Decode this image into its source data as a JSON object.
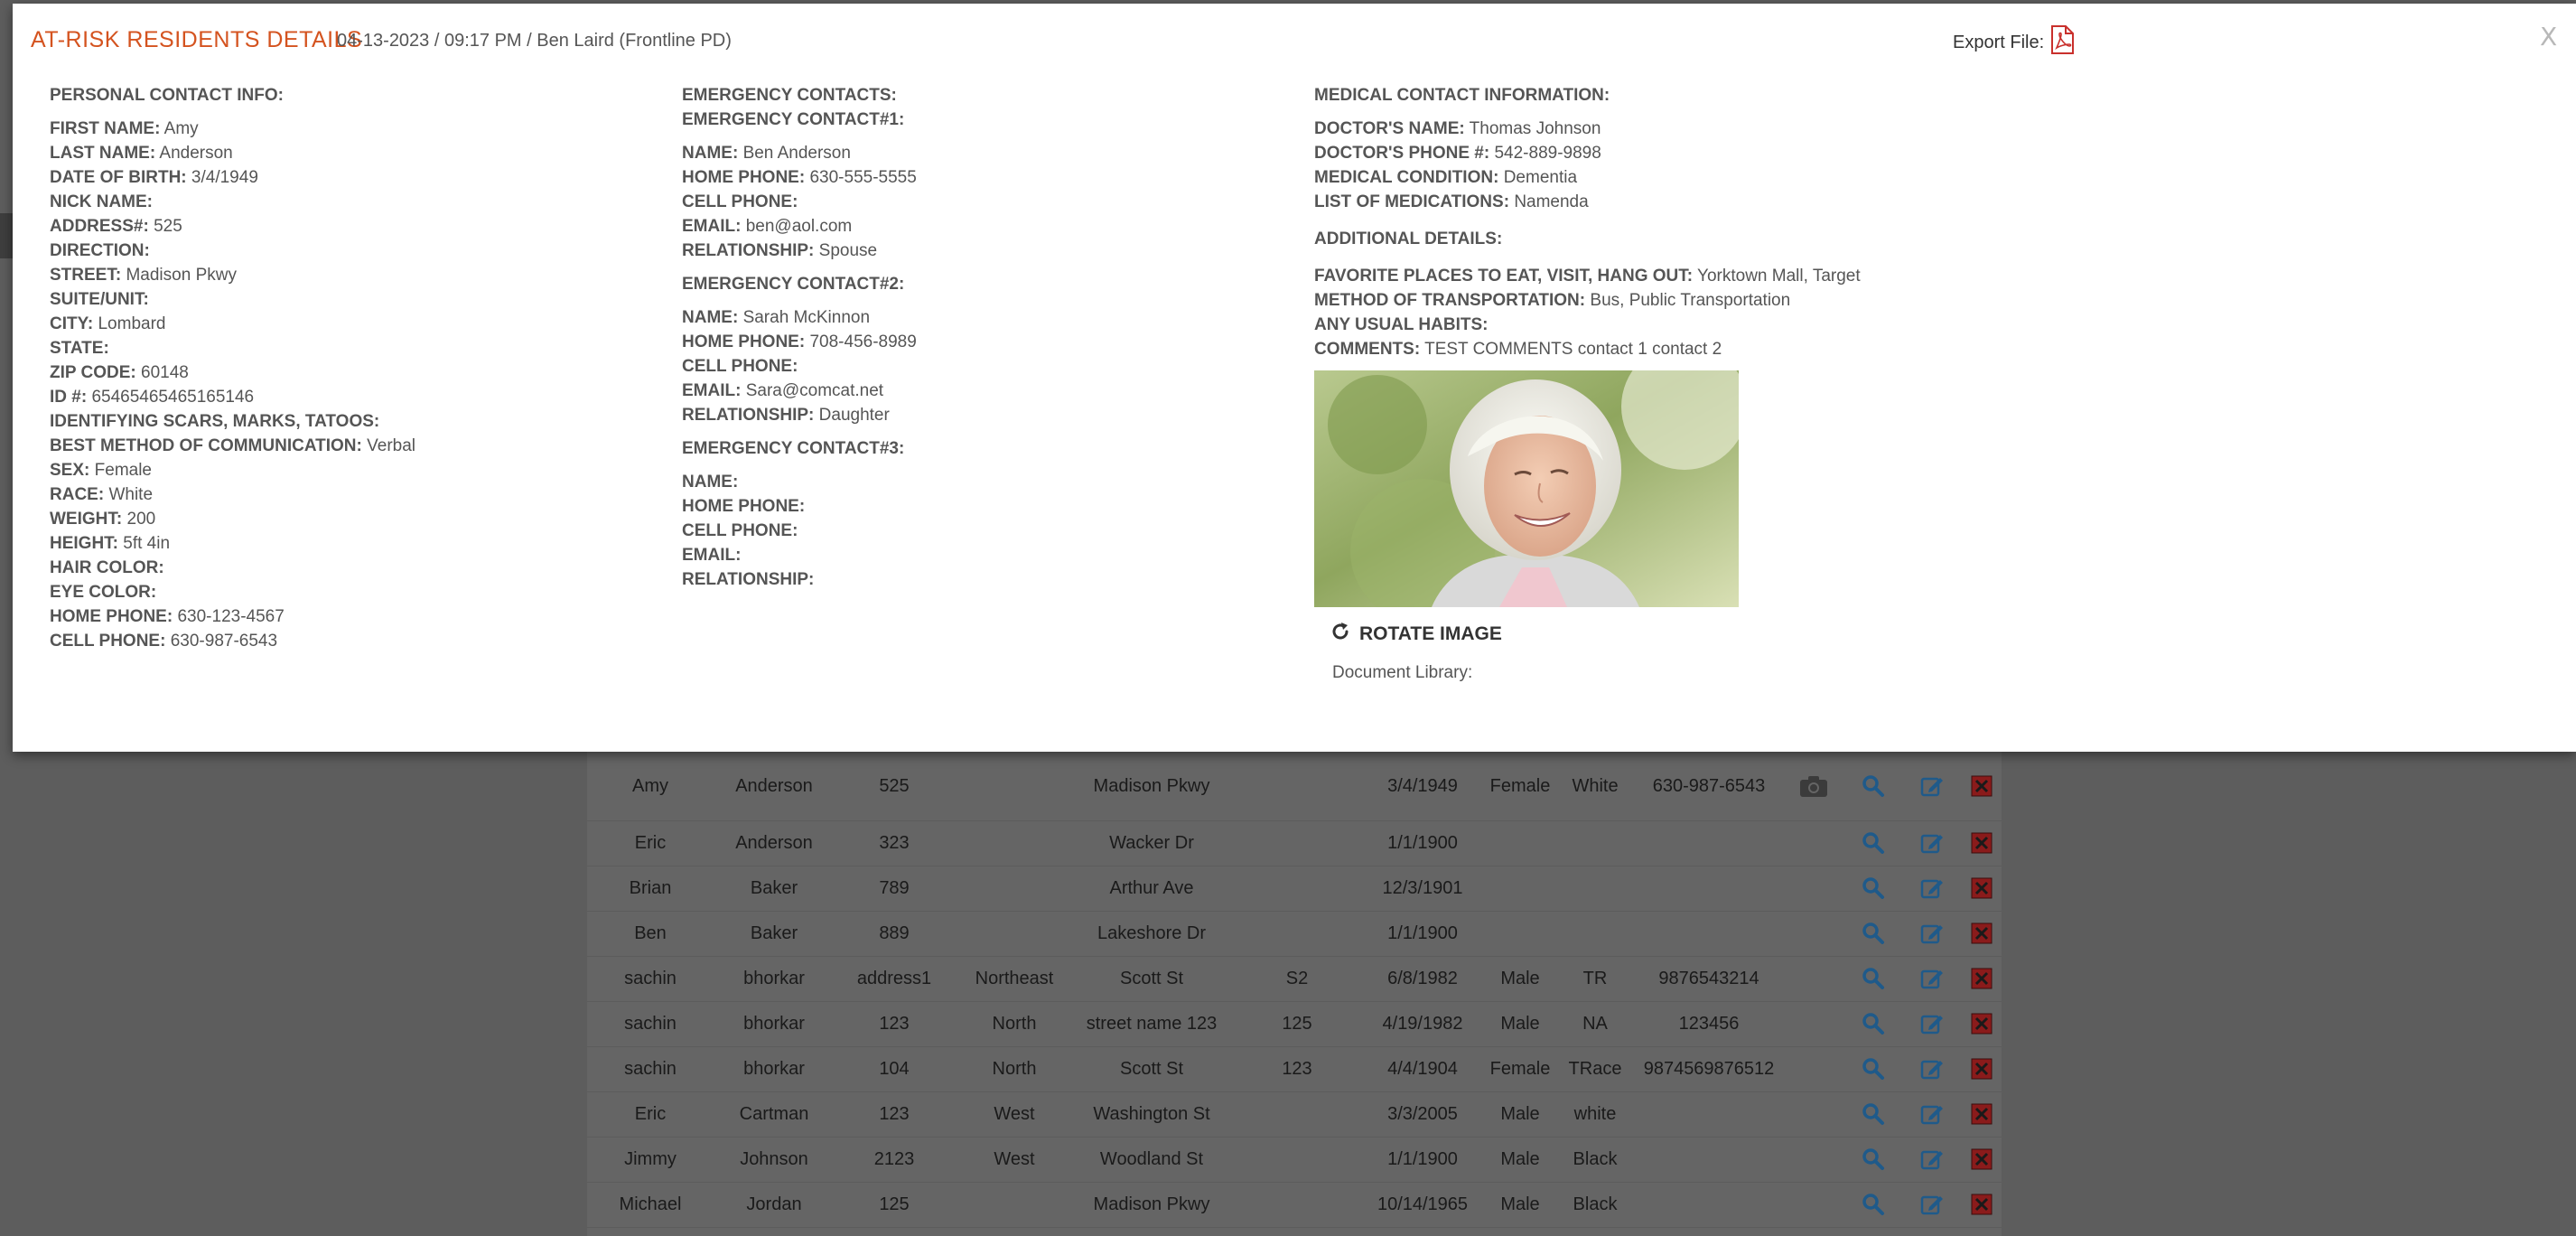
{
  "modal": {
    "title": "AT-RISK RESIDENTS DETAILS",
    "subtitle": "04-13-2023 / 09:17 PM / Ben Laird (Frontline PD)",
    "export_label": "Export File:",
    "close_label": "X"
  },
  "personal": {
    "heading": "PERSONAL CONTACT INFO:",
    "fields": [
      {
        "label": "FIRST NAME:",
        "value": "Amy"
      },
      {
        "label": "LAST NAME:",
        "value": "Anderson"
      },
      {
        "label": "DATE OF BIRTH:",
        "value": "3/4/1949"
      },
      {
        "label": "NICK NAME:",
        "value": ""
      },
      {
        "label": "ADDRESS#:",
        "value": "525"
      },
      {
        "label": "DIRECTION:",
        "value": ""
      },
      {
        "label": "STREET:",
        "value": "Madison Pkwy"
      },
      {
        "label": "SUITE/UNIT:",
        "value": ""
      },
      {
        "label": "CITY:",
        "value": "Lombard"
      },
      {
        "label": "STATE:",
        "value": ""
      },
      {
        "label": "ZIP CODE:",
        "value": "60148"
      },
      {
        "label": "ID #:",
        "value": "65465465465165146"
      },
      {
        "label": "IDENTIFYING SCARS, MARKS, TATOOS:",
        "value": ""
      },
      {
        "label": "BEST METHOD OF COMMUNICATION:",
        "value": "Verbal"
      },
      {
        "label": "SEX:",
        "value": "Female"
      },
      {
        "label": "RACE:",
        "value": "White"
      },
      {
        "label": "WEIGHT:",
        "value": "200"
      },
      {
        "label": "HEIGHT:",
        "value": "5ft 4in"
      },
      {
        "label": "HAIR COLOR:",
        "value": ""
      },
      {
        "label": "EYE COLOR:",
        "value": ""
      },
      {
        "label": "HOME PHONE:",
        "value": "630-123-4567"
      },
      {
        "label": "CELL PHONE:",
        "value": "630-987-6543"
      }
    ]
  },
  "emergency": {
    "heading": "EMERGENCY CONTACTS:",
    "contacts": [
      {
        "title": "EMERGENCY CONTACT#1:",
        "fields": [
          {
            "label": "NAME:",
            "value": "Ben Anderson"
          },
          {
            "label": "HOME PHONE:",
            "value": "630-555-5555"
          },
          {
            "label": "CELL PHONE:",
            "value": ""
          },
          {
            "label": "EMAIL:",
            "value": "ben@aol.com"
          },
          {
            "label": "RELATIONSHIP:",
            "value": "Spouse"
          }
        ]
      },
      {
        "title": "EMERGENCY CONTACT#2:",
        "fields": [
          {
            "label": "NAME:",
            "value": "Sarah McKinnon"
          },
          {
            "label": "HOME PHONE:",
            "value": "708-456-8989"
          },
          {
            "label": "CELL PHONE:",
            "value": ""
          },
          {
            "label": "EMAIL:",
            "value": "Sara@comcat.net"
          },
          {
            "label": "RELATIONSHIP:",
            "value": "Daughter"
          }
        ]
      },
      {
        "title": "EMERGENCY CONTACT#3:",
        "fields": [
          {
            "label": "NAME:",
            "value": ""
          },
          {
            "label": "HOME PHONE:",
            "value": ""
          },
          {
            "label": "CELL PHONE:",
            "value": ""
          },
          {
            "label": "EMAIL:",
            "value": ""
          },
          {
            "label": "RELATIONSHIP:",
            "value": ""
          }
        ]
      }
    ]
  },
  "medical": {
    "heading": "MEDICAL CONTACT INFORMATION:",
    "fields": [
      {
        "label": "DOCTOR'S NAME:",
        "value": "Thomas Johnson"
      },
      {
        "label": "DOCTOR'S PHONE #:",
        "value": "542-889-9898"
      },
      {
        "label": "MEDICAL CONDITION:",
        "value": "Dementia"
      },
      {
        "label": "LIST OF MEDICATIONS:",
        "value": "Namenda"
      }
    ]
  },
  "additional": {
    "heading": "ADDITIONAL DETAILS:",
    "fields": [
      {
        "label": "FAVORITE PLACES TO EAT, VISIT, HANG OUT:",
        "value": "Yorktown Mall, Target"
      },
      {
        "label": "METHOD OF TRANSPORTATION:",
        "value": "Bus, Public Transportation"
      },
      {
        "label": "ANY USUAL HABITS:",
        "value": ""
      },
      {
        "label": "COMMENTS:",
        "value": "TEST COMMENTS contact 1 contact 2"
      }
    ],
    "rotate_label": "ROTATE IMAGE",
    "document_library_label": "Document Library:"
  },
  "table": {
    "rows": [
      [
        "Amy",
        "Anderson",
        "525",
        "",
        "Madison Pkwy",
        "",
        "3/4/1949",
        "Female",
        "White",
        "630-987-6543"
      ],
      [
        "Eric",
        "Anderson",
        "323",
        "",
        "Wacker Dr",
        "",
        "1/1/1900",
        "",
        "",
        ""
      ],
      [
        "Brian",
        "Baker",
        "789",
        "",
        "Arthur Ave",
        "",
        "12/3/1901",
        "",
        "",
        ""
      ],
      [
        "Ben",
        "Baker",
        "889",
        "",
        "Lakeshore Dr",
        "",
        "1/1/1900",
        "",
        "",
        ""
      ],
      [
        "sachin",
        "bhorkar",
        "address1",
        "Northeast",
        "Scott St",
        "S2",
        "6/8/1982",
        "Male",
        "TR",
        "9876543214"
      ],
      [
        "sachin",
        "bhorkar",
        "123",
        "North",
        "street name 123",
        "125",
        "4/19/1982",
        "Male",
        "NA",
        "123456"
      ],
      [
        "sachin",
        "bhorkar",
        "104",
        "North",
        "Scott St",
        "123",
        "4/4/1904",
        "Female",
        "TRace",
        "9874569876512"
      ],
      [
        "Eric",
        "Cartman",
        "123",
        "West",
        "Washington St",
        "",
        "3/3/2005",
        "Male",
        "white",
        ""
      ],
      [
        "Jimmy",
        "Johnson",
        "2123",
        "West",
        "Woodland St",
        "",
        "1/1/1900",
        "Male",
        "Black",
        ""
      ],
      [
        "Michael",
        "Jordan",
        "125",
        "",
        "Madison Pkwy",
        "",
        "10/14/1965",
        "Male",
        "Black",
        ""
      ]
    ]
  },
  "colors": {
    "title_accent": "#d4531f",
    "pdf_icon": "#c9302c",
    "action_icon": "#1f5a8a",
    "delete_icon": "#8a1b1b"
  }
}
